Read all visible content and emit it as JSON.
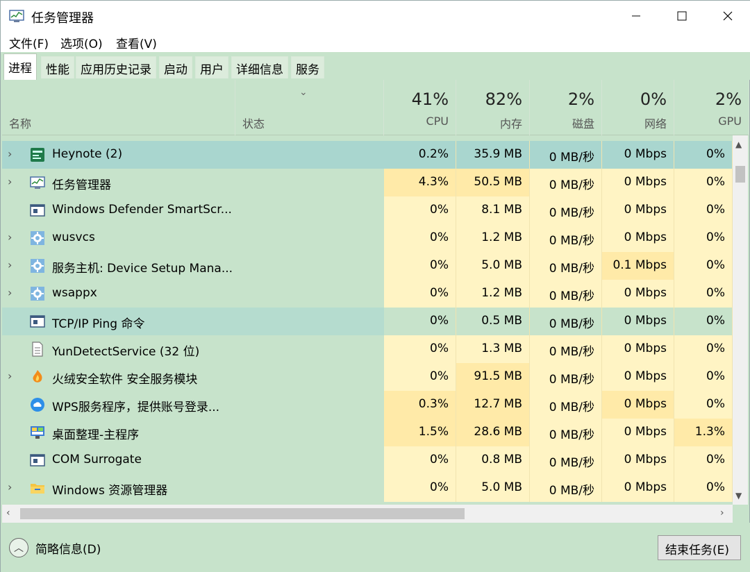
{
  "window": {
    "title": "任务管理器",
    "controls": {
      "minimize": "—",
      "maximize": "☐",
      "close": "✕"
    }
  },
  "menu": [
    "文件(F)",
    "选项(O)",
    "查看(V)"
  ],
  "tabs": [
    "进程",
    "性能",
    "应用历史记录",
    "启动",
    "用户",
    "详细信息",
    "服务"
  ],
  "active_tab": "进程",
  "header": {
    "name": "名称",
    "status": "状态",
    "cpu": {
      "pct": "41%",
      "label": "CPU"
    },
    "mem": {
      "pct": "82%",
      "label": "内存"
    },
    "disk": {
      "pct": "2%",
      "label": "磁盘"
    },
    "net": {
      "pct": "0%",
      "label": "网络"
    },
    "gpu": {
      "pct": "2%",
      "label": "GPU"
    }
  },
  "rows": [
    {
      "name": "Heynote (2)",
      "expand": true,
      "icon": "heynote-icon",
      "cpu": "0.2%",
      "mem": "35.9 MB",
      "disk": "0 MB/秒",
      "net": "0 Mbps",
      "gpu": "0%",
      "state": "selected",
      "heat": {
        "cpu": 0,
        "mem": 1,
        "disk": 0,
        "net": 0,
        "gpu": 0
      }
    },
    {
      "name": "任务管理器",
      "expand": true,
      "icon": "task-manager-icon",
      "cpu": "4.3%",
      "mem": "50.5 MB",
      "disk": "0 MB/秒",
      "net": "0 Mbps",
      "gpu": "0%",
      "state": "",
      "heat": {
        "cpu": 1,
        "mem": 1,
        "disk": 0,
        "net": 0,
        "gpu": 0
      }
    },
    {
      "name": "Windows Defender SmartScr...",
      "expand": false,
      "icon": "window-app-icon",
      "cpu": "0%",
      "mem": "8.1 MB",
      "disk": "0 MB/秒",
      "net": "0 Mbps",
      "gpu": "0%",
      "state": "",
      "heat": {
        "cpu": 0,
        "mem": 0,
        "disk": 0,
        "net": 0,
        "gpu": 0
      }
    },
    {
      "name": "wusvcs",
      "expand": true,
      "icon": "service-gear-icon",
      "cpu": "0%",
      "mem": "1.2 MB",
      "disk": "0 MB/秒",
      "net": "0 Mbps",
      "gpu": "0%",
      "state": "",
      "heat": {
        "cpu": 0,
        "mem": 0,
        "disk": 0,
        "net": 0,
        "gpu": 0
      }
    },
    {
      "name": "服务主机: Device Setup Mana...",
      "expand": true,
      "icon": "service-gear-icon",
      "cpu": "0%",
      "mem": "5.0 MB",
      "disk": "0 MB/秒",
      "net": "0.1 Mbps",
      "gpu": "0%",
      "state": "",
      "heat": {
        "cpu": 0,
        "mem": 0,
        "disk": 0,
        "net": 1,
        "gpu": 0
      }
    },
    {
      "name": "wsappx",
      "expand": true,
      "icon": "service-gear-icon",
      "cpu": "0%",
      "mem": "1.2 MB",
      "disk": "0 MB/秒",
      "net": "0 Mbps",
      "gpu": "0%",
      "state": "",
      "heat": {
        "cpu": 0,
        "mem": 0,
        "disk": 0,
        "net": 0,
        "gpu": 0
      }
    },
    {
      "name": "TCP/IP Ping 命令",
      "expand": false,
      "icon": "window-app-icon",
      "cpu": "0%",
      "mem": "0.5 MB",
      "disk": "0 MB/秒",
      "net": "0 Mbps",
      "gpu": "0%",
      "state": "hover",
      "heat": {
        "cpu": 0,
        "mem": 0,
        "disk": 0,
        "net": 0,
        "gpu": 0
      }
    },
    {
      "name": "YunDetectService (32 位)",
      "expand": false,
      "icon": "document-icon",
      "cpu": "0%",
      "mem": "1.3 MB",
      "disk": "0 MB/秒",
      "net": "0 Mbps",
      "gpu": "0%",
      "state": "",
      "heat": {
        "cpu": 0,
        "mem": 0,
        "disk": 0,
        "net": 0,
        "gpu": 0
      }
    },
    {
      "name": "火绒安全软件 安全服务模块",
      "expand": true,
      "icon": "shield-flame-icon",
      "cpu": "0%",
      "mem": "91.5 MB",
      "disk": "0 MB/秒",
      "net": "0 Mbps",
      "gpu": "0%",
      "state": "",
      "heat": {
        "cpu": 0,
        "mem": 1,
        "disk": 0,
        "net": 0,
        "gpu": 0
      }
    },
    {
      "name": "WPS服务程序，提供账号登录...",
      "expand": false,
      "icon": "cloud-icon",
      "cpu": "0.3%",
      "mem": "12.7 MB",
      "disk": "0 MB/秒",
      "net": "0 Mbps",
      "gpu": "0%",
      "state": "",
      "heat": {
        "cpu": 1,
        "mem": 1,
        "disk": 0,
        "net": 1,
        "gpu": 0
      }
    },
    {
      "name": "桌面整理-主程序",
      "expand": false,
      "icon": "monitor-icon",
      "cpu": "1.5%",
      "mem": "28.6 MB",
      "disk": "0 MB/秒",
      "net": "0 Mbps",
      "gpu": "1.3%",
      "state": "",
      "heat": {
        "cpu": 1,
        "mem": 1,
        "disk": 0,
        "net": 0,
        "gpu": 1
      }
    },
    {
      "name": "COM Surrogate",
      "expand": false,
      "icon": "window-app-icon",
      "cpu": "0%",
      "mem": "0.8 MB",
      "disk": "0 MB/秒",
      "net": "0 Mbps",
      "gpu": "0%",
      "state": "",
      "heat": {
        "cpu": 0,
        "mem": 0,
        "disk": 0,
        "net": 0,
        "gpu": 0
      }
    },
    {
      "name": "Windows 资源管理器",
      "expand": true,
      "icon": "folder-icon",
      "cpu": "0%",
      "mem": "5.0 MB",
      "disk": "0 MB/秒",
      "net": "0 Mbps",
      "gpu": "0%",
      "state": "",
      "heat": {
        "cpu": 0,
        "mem": 0,
        "disk": 0,
        "net": 0,
        "gpu": 0
      }
    }
  ],
  "footer": {
    "fewer_details": "简略信息(D)",
    "end_task": "结束任务(E)"
  },
  "colors": {
    "background": "#c7e3cb",
    "selected": "#a9d6cf",
    "heat_low": "#fff4c4",
    "heat_mid": "#ffeaa8"
  }
}
